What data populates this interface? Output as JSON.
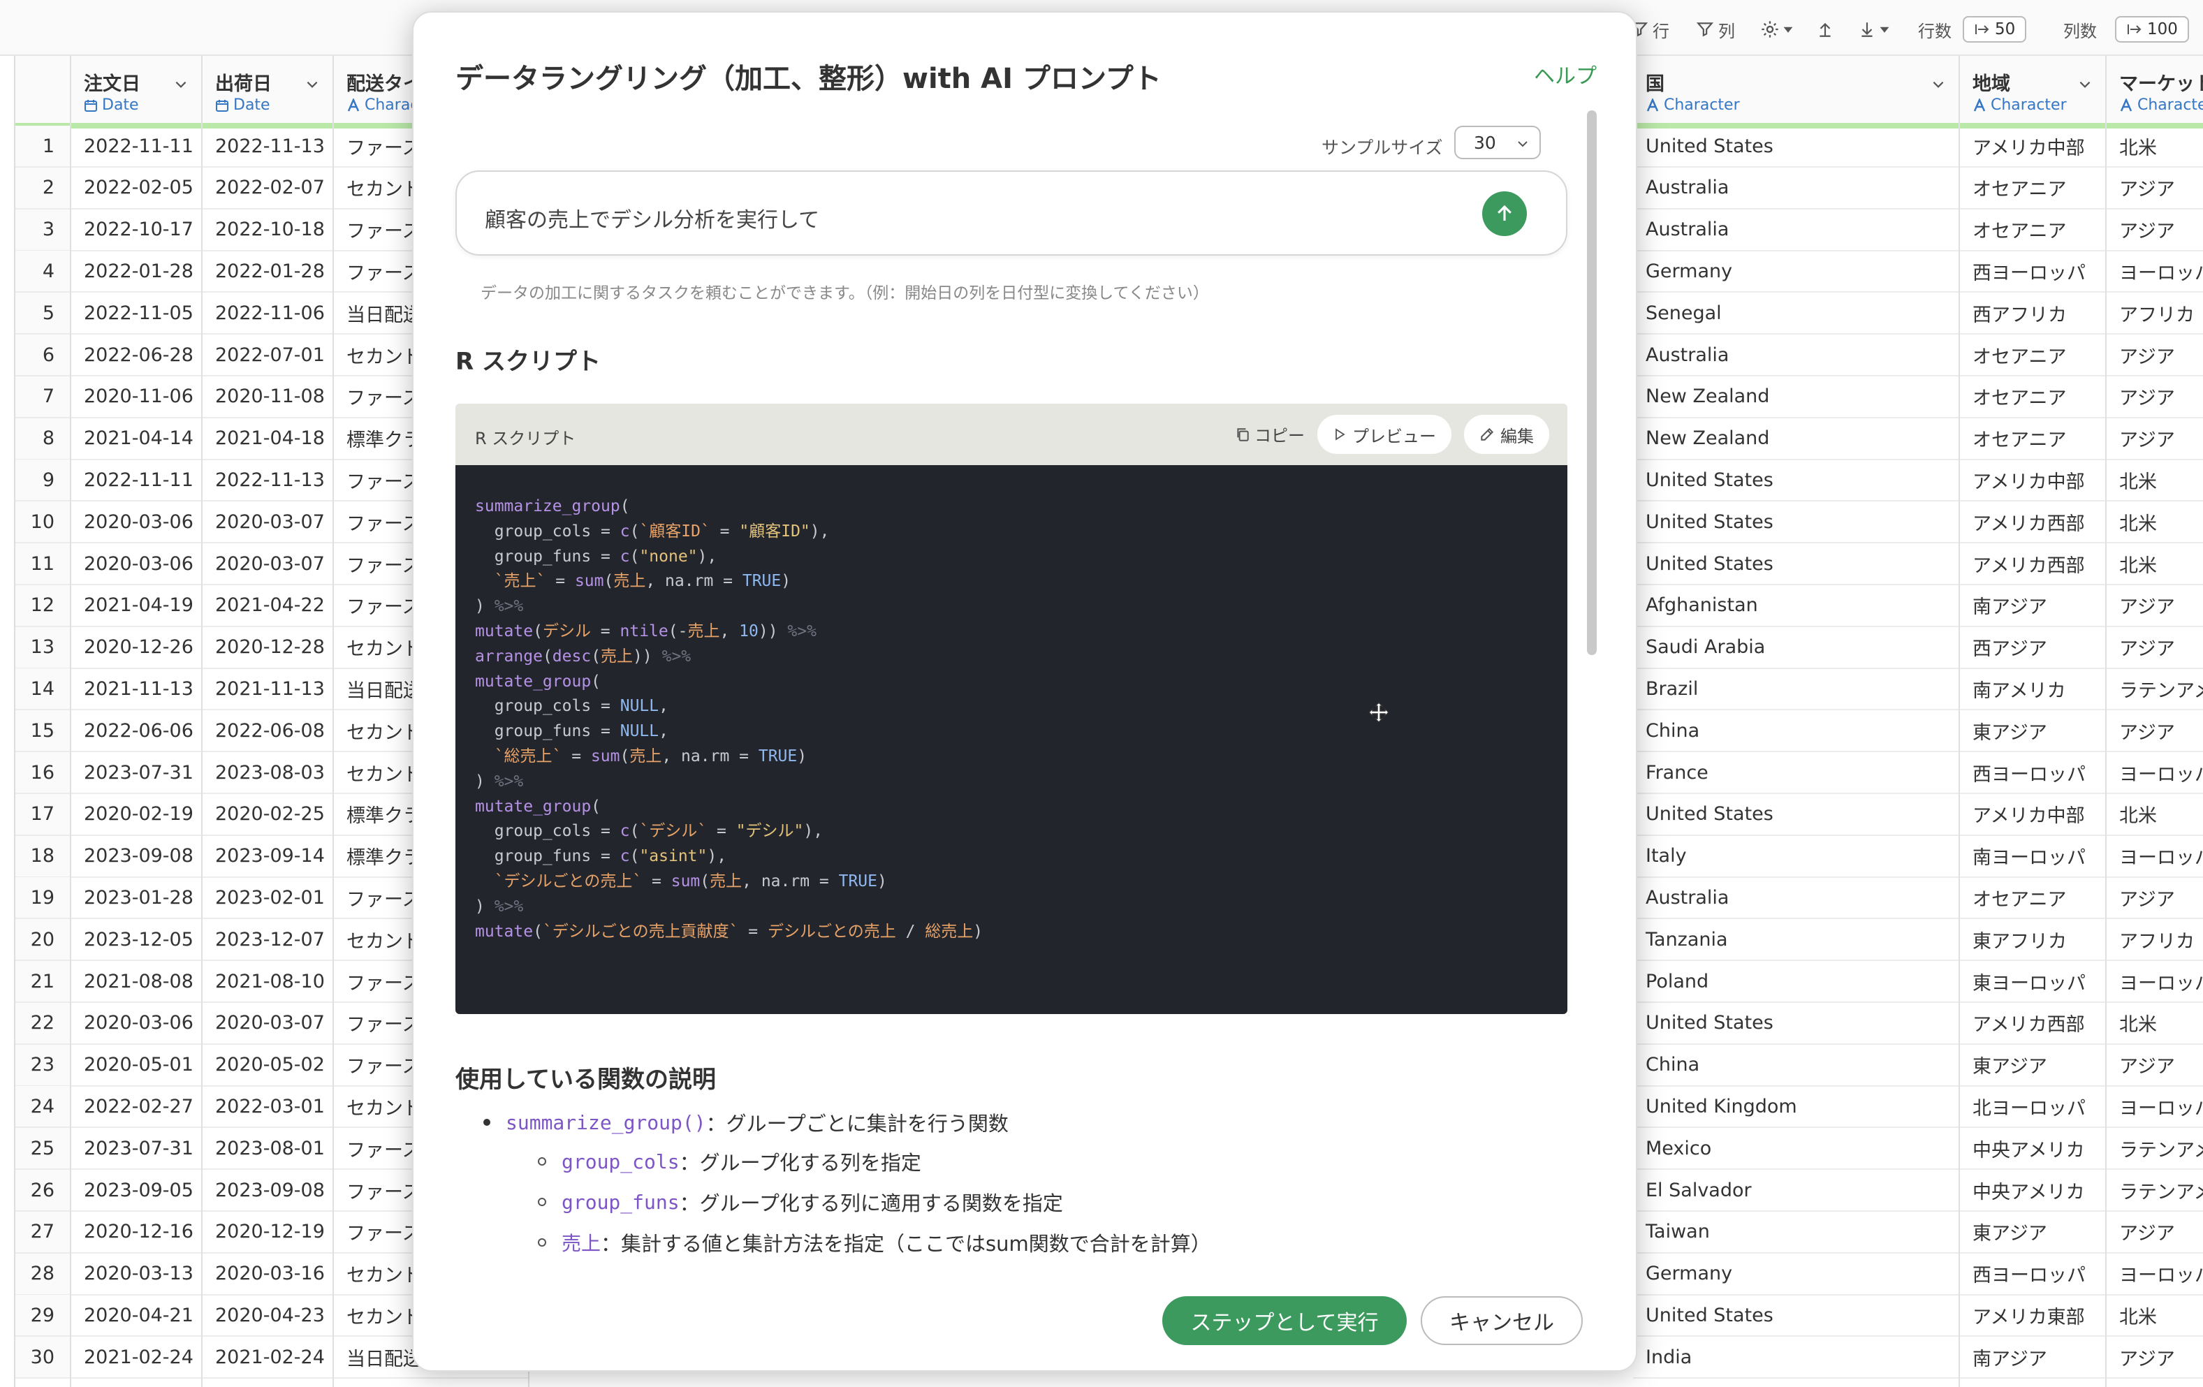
{
  "toolbar": {
    "row_filter": "行",
    "col_filter": "列",
    "rows_label": "行数",
    "rows_value": "50",
    "cols_label": "列数",
    "cols_value": "100"
  },
  "table": {
    "columns": [
      {
        "name": "注文日",
        "type": "Date"
      },
      {
        "name": "出荷日",
        "type": "Date"
      },
      {
        "name": "配送タイプ",
        "type": "Character"
      },
      {
        "name": "国",
        "type": "Character"
      },
      {
        "name": "地域",
        "type": "Character"
      },
      {
        "name": "マーケット",
        "type": "Character"
      }
    ],
    "rows": [
      {
        "n": "1",
        "order": "2022-11-11",
        "ship": "2022-11-13",
        "delivery": "ファースト",
        "country": "United States",
        "region": "アメリカ中部",
        "market": "北米"
      },
      {
        "n": "2",
        "order": "2022-02-05",
        "ship": "2022-02-07",
        "delivery": "セカンド",
        "country": "Australia",
        "region": "オセアニア",
        "market": "アジア"
      },
      {
        "n": "3",
        "order": "2022-10-17",
        "ship": "2022-10-18",
        "delivery": "ファースト",
        "country": "Australia",
        "region": "オセアニア",
        "market": "アジア"
      },
      {
        "n": "4",
        "order": "2022-01-28",
        "ship": "2022-01-28",
        "delivery": "ファースト",
        "country": "Germany",
        "region": "西ヨーロッパ",
        "market": "ヨーロッパ"
      },
      {
        "n": "5",
        "order": "2022-11-05",
        "ship": "2022-11-06",
        "delivery": "当日配送",
        "country": "Senegal",
        "region": "西アフリカ",
        "market": "アフリカ"
      },
      {
        "n": "6",
        "order": "2022-06-28",
        "ship": "2022-07-01",
        "delivery": "セカンド",
        "country": "Australia",
        "region": "オセアニア",
        "market": "アジア"
      },
      {
        "n": "7",
        "order": "2020-11-06",
        "ship": "2020-11-08",
        "delivery": "ファースト",
        "country": "New Zealand",
        "region": "オセアニア",
        "market": "アジア"
      },
      {
        "n": "8",
        "order": "2021-04-14",
        "ship": "2021-04-18",
        "delivery": "標準クラス",
        "country": "New Zealand",
        "region": "オセアニア",
        "market": "アジア"
      },
      {
        "n": "9",
        "order": "2022-11-11",
        "ship": "2022-11-13",
        "delivery": "ファースト",
        "country": "United States",
        "region": "アメリカ中部",
        "market": "北米"
      },
      {
        "n": "10",
        "order": "2020-03-06",
        "ship": "2020-03-07",
        "delivery": "ファースト",
        "country": "United States",
        "region": "アメリカ西部",
        "market": "北米"
      },
      {
        "n": "11",
        "order": "2020-03-06",
        "ship": "2020-03-07",
        "delivery": "ファースト",
        "country": "United States",
        "region": "アメリカ西部",
        "market": "北米"
      },
      {
        "n": "12",
        "order": "2021-04-19",
        "ship": "2021-04-22",
        "delivery": "ファースト",
        "country": "Afghanistan",
        "region": "南アジア",
        "market": "アジア"
      },
      {
        "n": "13",
        "order": "2020-12-26",
        "ship": "2020-12-28",
        "delivery": "セカンド",
        "country": "Saudi Arabia",
        "region": "西アジア",
        "market": "アジア"
      },
      {
        "n": "14",
        "order": "2021-11-13",
        "ship": "2021-11-13",
        "delivery": "当日配送",
        "country": "Brazil",
        "region": "南アメリカ",
        "market": "ラテンアメリカ"
      },
      {
        "n": "15",
        "order": "2022-06-06",
        "ship": "2022-06-08",
        "delivery": "セカンド",
        "country": "China",
        "region": "東アジア",
        "market": "アジア"
      },
      {
        "n": "16",
        "order": "2023-07-31",
        "ship": "2023-08-03",
        "delivery": "セカンド",
        "country": "France",
        "region": "西ヨーロッパ",
        "market": "ヨーロッパ"
      },
      {
        "n": "17",
        "order": "2020-02-19",
        "ship": "2020-02-25",
        "delivery": "標準クラス",
        "country": "United States",
        "region": "アメリカ中部",
        "market": "北米"
      },
      {
        "n": "18",
        "order": "2023-09-08",
        "ship": "2023-09-14",
        "delivery": "標準クラス",
        "country": "Italy",
        "region": "南ヨーロッパ",
        "market": "ヨーロッパ"
      },
      {
        "n": "19",
        "order": "2023-01-28",
        "ship": "2023-02-01",
        "delivery": "ファースト",
        "country": "Australia",
        "region": "オセアニア",
        "market": "アジア"
      },
      {
        "n": "20",
        "order": "2023-12-05",
        "ship": "2023-12-07",
        "delivery": "セカンド",
        "country": "Tanzania",
        "region": "東アフリカ",
        "market": "アフリカ"
      },
      {
        "n": "21",
        "order": "2021-08-08",
        "ship": "2021-08-10",
        "delivery": "ファースト",
        "country": "Poland",
        "region": "東ヨーロッパ",
        "market": "ヨーロッパ"
      },
      {
        "n": "22",
        "order": "2020-03-06",
        "ship": "2020-03-07",
        "delivery": "ファースト",
        "country": "United States",
        "region": "アメリカ西部",
        "market": "北米"
      },
      {
        "n": "23",
        "order": "2020-05-01",
        "ship": "2020-05-02",
        "delivery": "ファースト",
        "country": "China",
        "region": "東アジア",
        "market": "アジア"
      },
      {
        "n": "24",
        "order": "2022-02-27",
        "ship": "2022-03-01",
        "delivery": "セカンド",
        "country": "United Kingdom",
        "region": "北ヨーロッパ",
        "market": "ヨーロッパ"
      },
      {
        "n": "25",
        "order": "2023-07-31",
        "ship": "2023-08-01",
        "delivery": "ファースト",
        "country": "Mexico",
        "region": "中央アメリカ",
        "market": "ラテンアメリカ"
      },
      {
        "n": "26",
        "order": "2023-09-05",
        "ship": "2023-09-08",
        "delivery": "ファースト",
        "country": "El Salvador",
        "region": "中央アメリカ",
        "market": "ラテンアメリカ"
      },
      {
        "n": "27",
        "order": "2020-12-16",
        "ship": "2020-12-19",
        "delivery": "ファースト",
        "country": "Taiwan",
        "region": "東アジア",
        "market": "アジア"
      },
      {
        "n": "28",
        "order": "2020-03-13",
        "ship": "2020-03-16",
        "delivery": "セカンド",
        "country": "Germany",
        "region": "西ヨーロッパ",
        "market": "ヨーロッパ"
      },
      {
        "n": "29",
        "order": "2020-04-21",
        "ship": "2020-04-23",
        "delivery": "セカンド",
        "country": "United States",
        "region": "アメリカ東部",
        "market": "北米"
      },
      {
        "n": "30",
        "order": "2021-02-24",
        "ship": "2021-02-24",
        "delivery": "当日配送",
        "country": "India",
        "region": "南アジア",
        "market": "アジア"
      }
    ]
  },
  "modal": {
    "title": "データラングリング（加工、整形）with AI プロンプト",
    "help": "ヘルプ",
    "sample_label": "サンプルサイズ",
    "sample_value": "30",
    "prompt_text": "顧客の売上でデシル分析を実行して",
    "hint": "データの加工に関するタスクを頼むことができます。（例：開始日の列を日付型に変換してください）",
    "r_script_heading": "R スクリプト",
    "code_panel_label": "R スクリプト",
    "copy_label": "コピー",
    "preview_label": "プレビュー",
    "edit_label": "編集",
    "functions_heading": "使用している関数の説明",
    "functions": [
      {
        "name": "summarize_group()",
        "desc": "：グループごとに集計を行う関数"
      },
      {
        "name": "group_cols",
        "desc": "：グループ化する列を指定"
      },
      {
        "name": "group_funs",
        "desc": "：グループ化する列に適用する関数を指定"
      },
      {
        "name": "売上",
        "desc": "：集計する値と集計方法を指定（ここではsum関数で合計を計算）"
      }
    ],
    "execute_button": "ステップとして実行",
    "cancel_button": "キャンセル"
  },
  "colors": {
    "accent_green": "#3d9a5e",
    "type_blue": "#3577c4",
    "code_bg": "#23252c"
  }
}
